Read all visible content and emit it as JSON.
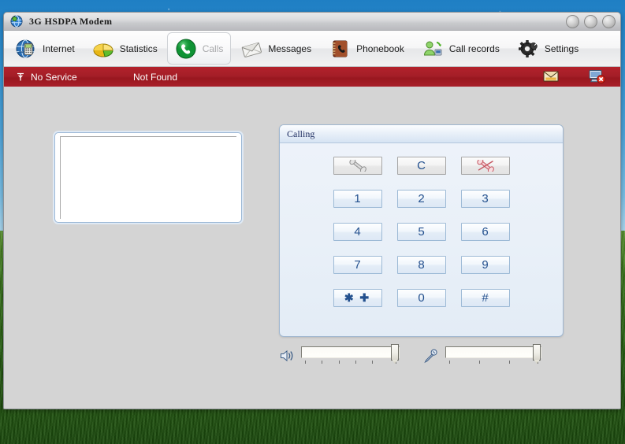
{
  "window": {
    "title": "3G HSDPA Modem",
    "app_icon": "globe-modem-icon",
    "buttons": {
      "minimize": "minimize-button",
      "maximize": "maximize-button",
      "close": "close-button"
    }
  },
  "toolbar": {
    "items": [
      {
        "label": "Internet",
        "icon": "globe-internet-icon",
        "selected": false
      },
      {
        "label": "Statistics",
        "icon": "pie-chart-icon",
        "selected": false
      },
      {
        "label": "Calls",
        "icon": "green-phone-icon",
        "selected": true
      },
      {
        "label": "Messages",
        "icon": "envelope-icon",
        "selected": false
      },
      {
        "label": "Phonebook",
        "icon": "address-book-icon",
        "selected": false
      },
      {
        "label": "Call records",
        "icon": "contacts-sync-icon",
        "selected": false
      },
      {
        "label": "Settings",
        "icon": "gear-wrench-icon",
        "selected": false
      }
    ]
  },
  "status": {
    "signal_icon": "antenna-no-signal-icon",
    "network": "No Service",
    "provider": "Not Found",
    "message_icon": "new-message-icon",
    "connection_icon": "disconnected-pc-icon"
  },
  "dialer": {
    "number_value": "",
    "number_placeholder": ""
  },
  "calling": {
    "title": "Calling",
    "keys": [
      {
        "label": "",
        "name": "call-button",
        "icon": "phone-handset-icon",
        "type": "func"
      },
      {
        "label": "C",
        "name": "clear-button",
        "icon": "",
        "type": "func"
      },
      {
        "label": "",
        "name": "hangup-button",
        "icon": "hangup-phone-icon",
        "type": "func"
      },
      {
        "label": "1",
        "name": "key-1",
        "icon": "",
        "type": "digit"
      },
      {
        "label": "2",
        "name": "key-2",
        "icon": "",
        "type": "digit"
      },
      {
        "label": "3",
        "name": "key-3",
        "icon": "",
        "type": "digit"
      },
      {
        "label": "4",
        "name": "key-4",
        "icon": "",
        "type": "digit"
      },
      {
        "label": "5",
        "name": "key-5",
        "icon": "",
        "type": "digit"
      },
      {
        "label": "6",
        "name": "key-6",
        "icon": "",
        "type": "digit"
      },
      {
        "label": "7",
        "name": "key-7",
        "icon": "",
        "type": "digit"
      },
      {
        "label": "8",
        "name": "key-8",
        "icon": "",
        "type": "digit"
      },
      {
        "label": "9",
        "name": "key-9",
        "icon": "",
        "type": "digit"
      },
      {
        "label": "✱ ✚",
        "name": "key-star-plus",
        "icon": "",
        "type": "starplus"
      },
      {
        "label": "0",
        "name": "key-0",
        "icon": "",
        "type": "digit"
      },
      {
        "label": "#",
        "name": "key-hash",
        "icon": "",
        "type": "digit"
      }
    ]
  },
  "sliders": {
    "speaker": {
      "icon": "speaker-volume-icon",
      "value_percent": 100,
      "ticks": 6
    },
    "microphone": {
      "icon": "microphone-icon",
      "value_percent": 100,
      "ticks": 4
    }
  },
  "colors": {
    "status_red": "#a41e27",
    "panel_blue": "#e9f0f8",
    "key_text": "#23508e",
    "window_gray": "#d4d4d4"
  }
}
